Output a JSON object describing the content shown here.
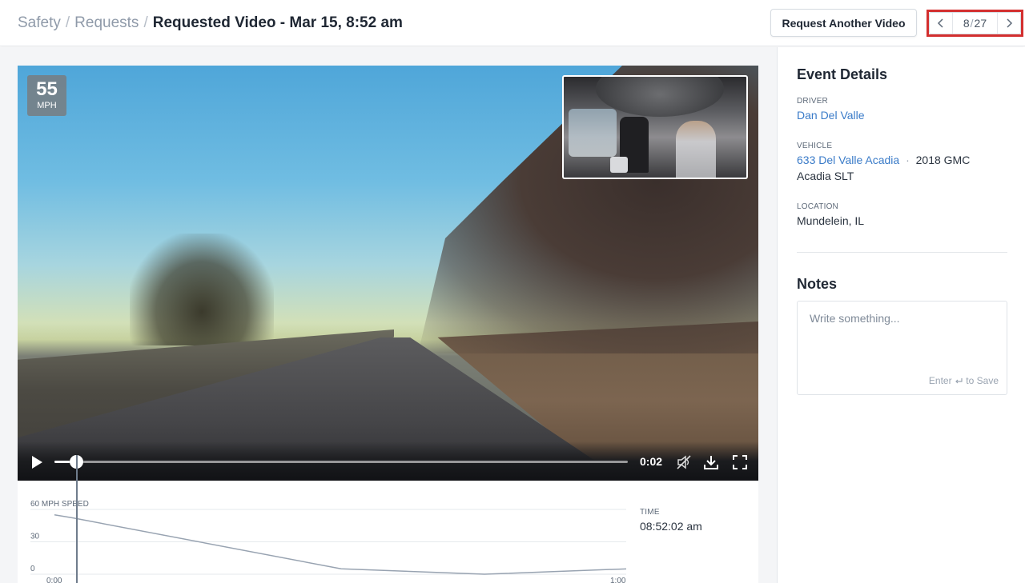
{
  "breadcrumb": {
    "items": [
      "Safety",
      "Requests"
    ],
    "separator": "/",
    "current": "Requested Video - Mar 15, 8:52 am"
  },
  "header": {
    "request_button_label": "Request Another Video",
    "pager": {
      "current": "8",
      "separator": "/",
      "total": "27"
    }
  },
  "video": {
    "speed_value": "55",
    "speed_unit": "MPH",
    "current_time": "0:02",
    "progress_fraction": 0.038,
    "icons": [
      "play-icon",
      "mute-icon",
      "download-icon",
      "fullscreen-icon"
    ]
  },
  "speed_chart": {
    "time_caption": "TIME",
    "time_value": "08:52:02 am"
  },
  "chart_data": {
    "type": "line",
    "title": "",
    "ylabel": "60 MPH SPEED",
    "y_ticks": [
      "30",
      "0"
    ],
    "x_tick_labels": [
      "0:00",
      "1:00"
    ],
    "ylim": [
      0,
      60
    ],
    "xlim": [
      0,
      60
    ],
    "series": [
      {
        "x": [
          0,
          2,
          30,
          45,
          60
        ],
        "y": [
          55,
          52,
          5,
          0,
          5
        ]
      }
    ],
    "cursor_x": 2,
    "grid": true
  },
  "event_details": {
    "title": "Event Details",
    "driver_caption": "DRIVER",
    "driver_name": "Dan Del Valle",
    "vehicle_caption": "VEHICLE",
    "vehicle_link": "633 Del Valle Acadia",
    "vehicle_separator": "·",
    "vehicle_model": "2018 GMC Acadia SLT",
    "location_caption": "LOCATION",
    "location_value": "Mundelein, IL"
  },
  "notes": {
    "title": "Notes",
    "placeholder": "Write something...",
    "hint_prefix": "Enter",
    "hint_icon": "enter-icon",
    "hint_suffix": "to Save"
  },
  "colors": {
    "link": "#3a7bc8",
    "highlight_border": "#d32f2f",
    "chart_line": "#98a3b1"
  }
}
